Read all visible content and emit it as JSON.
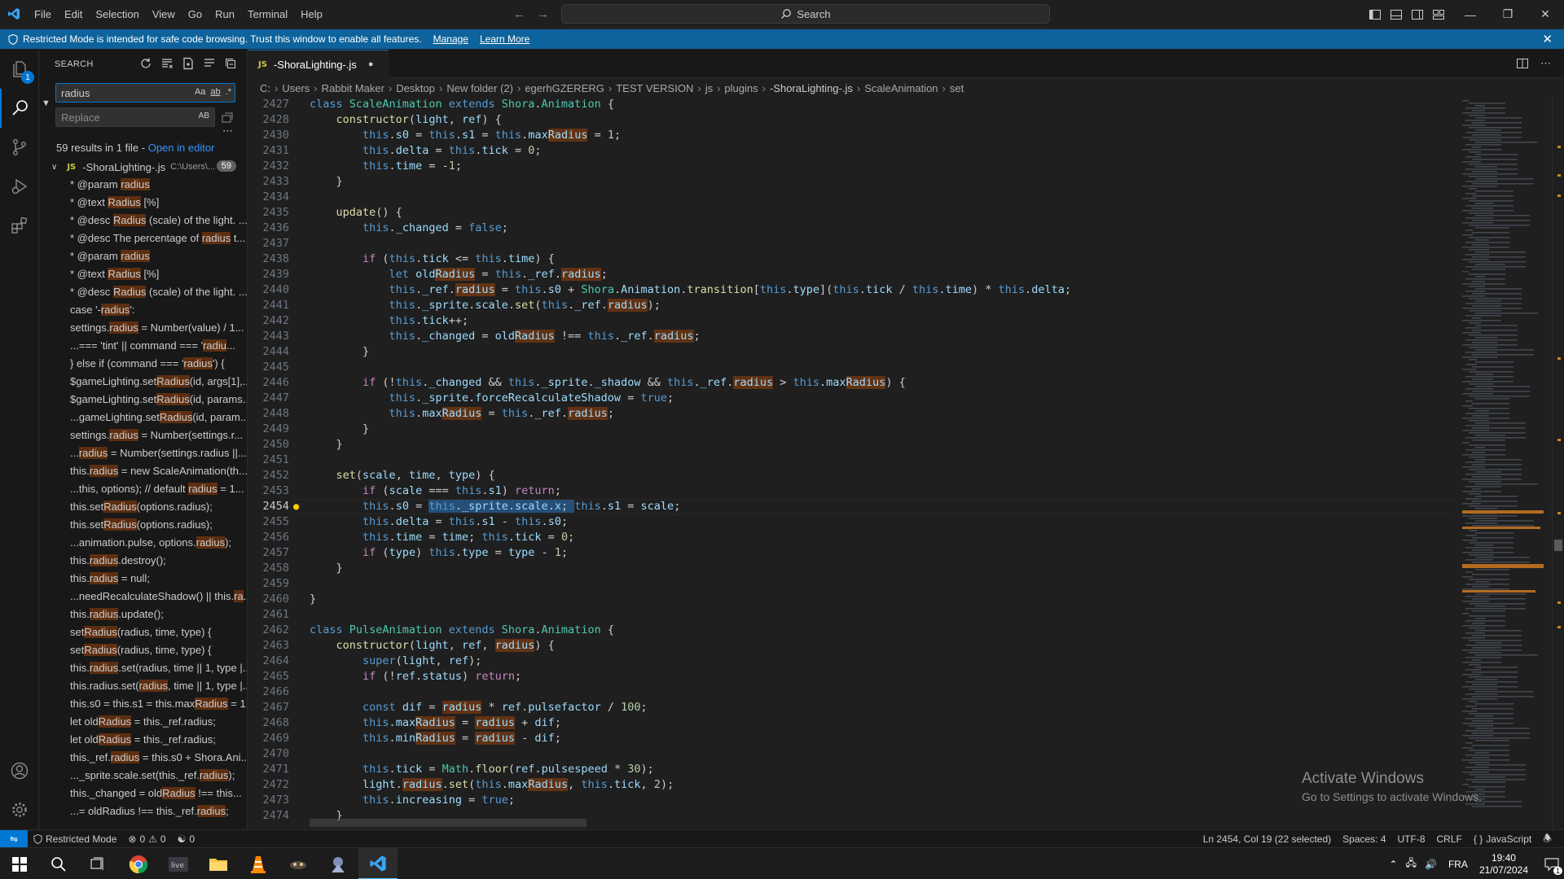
{
  "colors": {
    "accent": "#0078d4",
    "banner": "#0e639c",
    "match": "#ea5c00",
    "js": "#cbcb41"
  },
  "menu": [
    "File",
    "Edit",
    "Selection",
    "View",
    "Go",
    "Run",
    "Terminal",
    "Help"
  ],
  "command_center": "Search",
  "banner": {
    "message": "Restricted Mode is intended for safe code browsing. Trust this window to enable all features.",
    "manage": "Manage",
    "learn_more": "Learn More"
  },
  "activity": {
    "explorer_badge": "1"
  },
  "sidebar": {
    "title": "SEARCH",
    "search_value": "radius",
    "replace_placeholder": "Replace",
    "toggle_case": "Aa",
    "toggle_word": "ab",
    "toggle_regex": ".*",
    "toggle_preserve": "AB",
    "results_summary": "59 results in 1 file - ",
    "open_in_editor": "Open in editor",
    "file_name": "-ShoraLighting-.js",
    "file_path": "C:\\Users\\...",
    "file_count": "59",
    "results": [
      [
        "* @param ",
        "radius",
        ""
      ],
      [
        "* @text ",
        "Radius",
        " [%]"
      ],
      [
        "* @desc ",
        "Radius",
        " (scale) of the light. ..."
      ],
      [
        "* @desc The percentage of ",
        "radius",
        " t..."
      ],
      [
        "* @param ",
        "radius",
        ""
      ],
      [
        "* @text ",
        "Radius",
        " [%]"
      ],
      [
        "* @desc ",
        "Radius",
        " (scale) of the light. ..."
      ],
      [
        "case '-",
        "radius",
        "':"
      ],
      [
        "settings.",
        "radius",
        " = Number(value) / 1..."
      ],
      [
        "...=== 'tint' || command === '",
        "radiu",
        "..."
      ],
      [
        "} else if (command === '",
        "radius",
        "') {"
      ],
      [
        "$gameLighting.set",
        "Radius",
        "(id, args[1],..."
      ],
      [
        "$gameLighting.set",
        "Radius",
        "(id, params..."
      ],
      [
        "...gameLighting.set",
        "Radius",
        "(id, param..."
      ],
      [
        "settings.",
        "radius",
        " = Number(settings.r..."
      ],
      [
        "...",
        "radius",
        " = Number(settings.radius ||..."
      ],
      [
        "this.",
        "radius",
        " = new ScaleAnimation(th..."
      ],
      [
        "...this, options); // default ",
        "radius",
        " = 1..."
      ],
      [
        "this.set",
        "Radius",
        "(options.radius);"
      ],
      [
        "this.set",
        "Radius",
        "(options.radius);"
      ],
      [
        "...animation.pulse, options.",
        "radius",
        ");"
      ],
      [
        "this.",
        "radius",
        ".destroy();"
      ],
      [
        "this.",
        "radius",
        " = null;"
      ],
      [
        "...needRecalculateShadow() || this.",
        "ra",
        "..."
      ],
      [
        "this.",
        "radius",
        ".update();"
      ],
      [
        "set",
        "Radius",
        "(radius, time, type) {"
      ],
      [
        "set",
        "Radius",
        "(radius, time, type) {"
      ],
      [
        "this.",
        "radius",
        ".set(radius, time || 1, type |..."
      ],
      [
        "this.radius.set(",
        "radius",
        ", time || 1, type |..."
      ],
      [
        "this.s0 = this.s1 = this.max",
        "Radius",
        " = 1;"
      ],
      [
        "let old",
        "Radius",
        " = this._ref.radius;"
      ],
      [
        "let old",
        "Radius",
        " = this._ref.radius;"
      ],
      [
        "this._ref.",
        "radius",
        " = this.s0 + Shora.Ani..."
      ],
      [
        "..._sprite.scale.set(this._ref.",
        "radius",
        ");"
      ],
      [
        "this._changed = old",
        "Radius",
        " !== this..."
      ],
      [
        "...= oldRadius !== this._ref.",
        "radius",
        ";"
      ]
    ]
  },
  "tab": {
    "label": "-ShoraLighting-.js",
    "modified": "●"
  },
  "breadcrumb": [
    "C:",
    "Users",
    "Rabbit Maker",
    "Desktop",
    "New folder (2)",
    "egerhGZERERG",
    "TEST VERSION",
    "js",
    "plugins",
    "-ShoraLighting-.js",
    "ScaleAnimation",
    "set"
  ],
  "code_lines": [
    "2427",
    "2428",
    "2430",
    "2431",
    "2432",
    "2433",
    "2434",
    "2435",
    "2436",
    "2437",
    "2438",
    "2439",
    "2440",
    "2441",
    "2442",
    "2443",
    "2444",
    "2445",
    "2446",
    "2447",
    "2448",
    "2449",
    "2450",
    "2451",
    "2452",
    "2453",
    "2454",
    "2455",
    "2456",
    "2457",
    "2458",
    "2459",
    "2460",
    "2461",
    "2462",
    "2463",
    "2464",
    "2465",
    "2466",
    "2467",
    "2468",
    "2469",
    "2470",
    "2471",
    "2472",
    "2473",
    "2474"
  ],
  "current_line": "2454",
  "watermark": {
    "title": "Activate Windows",
    "subtitle": "Go to Settings to activate Windows."
  },
  "status": {
    "restricted": "Restricted Mode",
    "errors": "0",
    "warnings": "0",
    "ports": "0",
    "position": "Ln 2454, Col 19 (22 selected)",
    "spaces": "Spaces: 4",
    "encoding": "UTF-8",
    "eol": "CRLF",
    "language": "JavaScript"
  },
  "taskbar": {
    "lang": "FRA",
    "time": "19:40",
    "date": "21/07/2024",
    "notif": "1",
    "apps": [
      "start-icon",
      "search-icon",
      "task-view-icon",
      "chrome-icon",
      "live-icon",
      "file-explorer-icon",
      "vlc-icon",
      "game-icon",
      "game2-icon",
      "vscode-icon"
    ]
  }
}
